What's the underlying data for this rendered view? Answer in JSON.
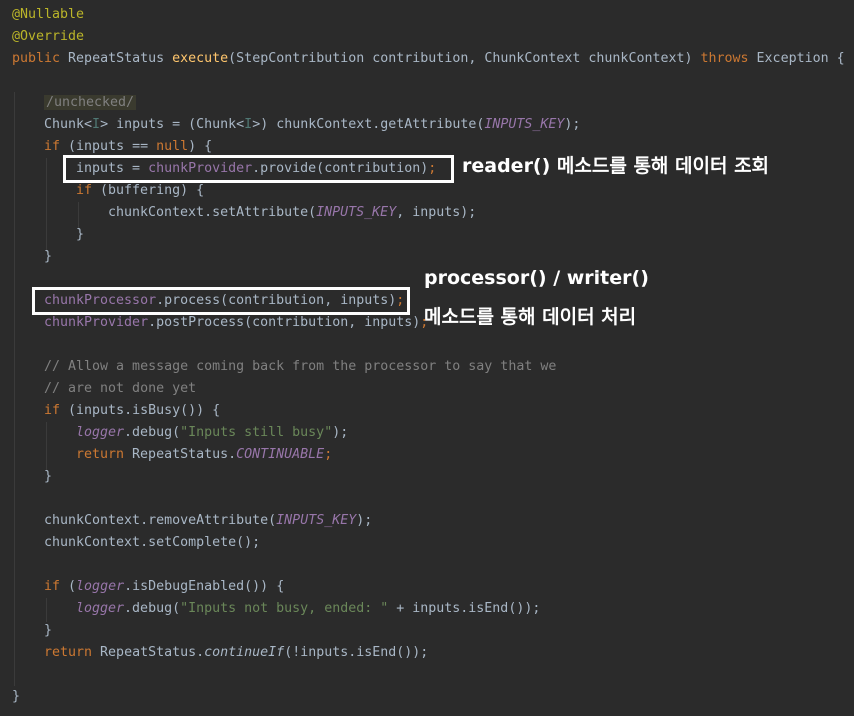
{
  "code": {
    "l1": "@Nullable",
    "l2": "@Override",
    "l3": {
      "public": "public ",
      "rtype": "RepeatStatus ",
      "method": "execute",
      "params": "(StepContribution contribution, ChunkContext chunkContext) ",
      "throws": "throws ",
      "exc": "Exception {"
    },
    "l5": "/unchecked/",
    "l6": {
      "a": "Chunk<",
      "g1": "I",
      "b": "> inputs = (Chunk<",
      "g2": "I",
      "c": ">) chunkContext.getAttribute(",
      "k": "INPUTS_KEY",
      "d": ");"
    },
    "l7": {
      "if": "if ",
      "a": "(inputs == ",
      "null": "null",
      "b": ") {"
    },
    "l8": {
      "a": "inputs = ",
      "f": "chunkProvider",
      "b": ".provide(contribution)",
      "semi": ";"
    },
    "l9": {
      "if": "if ",
      "a": "(buffering) {"
    },
    "l10": {
      "a": "chunkContext.setAttribute(",
      "k": "INPUTS_KEY",
      "b": ", inputs);"
    },
    "l11": "}",
    "l12": "}",
    "l14": {
      "f": "chunkProcessor",
      "a": ".process(contribution, inputs)",
      "semi": ";"
    },
    "l15": {
      "f": "chunkProvider",
      "a": ".postProcess(contribution, inputs)",
      "semi": ";"
    },
    "l17": "// Allow a message coming back from the processor to say that we",
    "l18": "// are not done yet",
    "l19": {
      "if": "if ",
      "a": "(inputs.isBusy()) {"
    },
    "l20": {
      "f": "logger",
      "a": ".debug(",
      "s": "\"Inputs still busy\"",
      "b": ");"
    },
    "l21": {
      "ret": "return ",
      "a": "RepeatStatus.",
      "c": "CONTINUABLE",
      "b": ";"
    },
    "l22": "}",
    "l24": {
      "a": "chunkContext.removeAttribute(",
      "k": "INPUTS_KEY",
      "b": ");"
    },
    "l25": "chunkContext.setComplete();",
    "l27": {
      "if": "if ",
      "a": "(",
      "f": "logger",
      "b": ".isDebugEnabled()) {"
    },
    "l28": {
      "f": "logger",
      "a": ".debug(",
      "s": "\"Inputs not busy, ended: \"",
      "b": " + inputs.isEnd());"
    },
    "l29": "}",
    "l30": {
      "ret": "return ",
      "a": "RepeatStatus.",
      "m": "continueIf",
      "b": "(!inputs.isEnd());"
    },
    "l32": "}"
  },
  "annotations": {
    "reader": "reader() 메소드를 통해 데이터 조회",
    "processor_line1": "processor() / writer()",
    "processor_line2": "메소드를 통해 데이터 처리"
  }
}
